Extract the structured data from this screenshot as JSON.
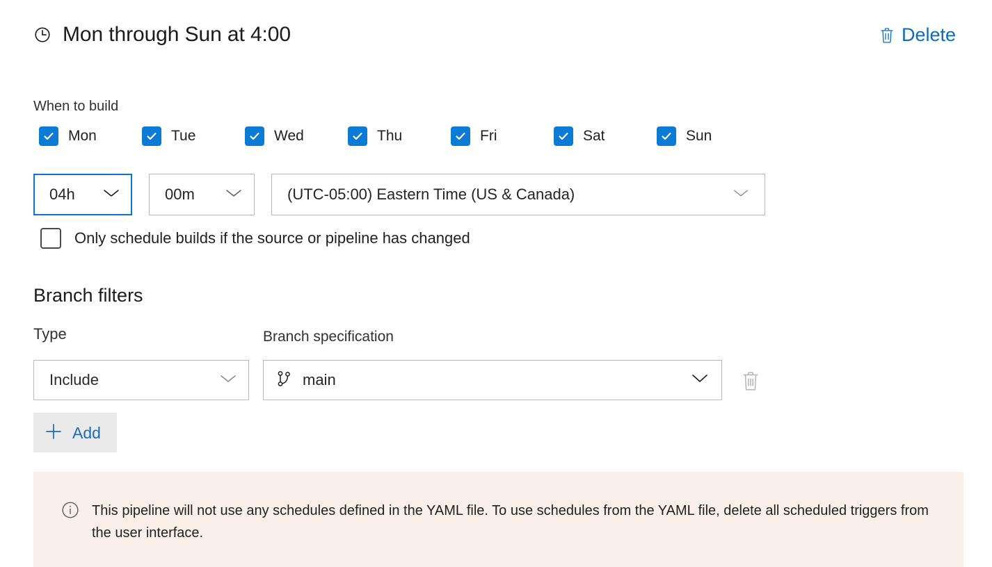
{
  "header": {
    "clock_icon": "clock-icon",
    "title": "Mon through Sun at 4:00",
    "delete_label": "Delete",
    "delete_icon": "trash-icon",
    "accent_color": "#0b6cbf"
  },
  "when_to_build": {
    "label": "When to build",
    "days": [
      {
        "label": "Mon",
        "checked": true
      },
      {
        "label": "Tue",
        "checked": true
      },
      {
        "label": "Wed",
        "checked": true
      },
      {
        "label": "Thu",
        "checked": true
      },
      {
        "label": "Fri",
        "checked": true
      },
      {
        "label": "Sat",
        "checked": true
      },
      {
        "label": "Sun",
        "checked": true
      }
    ],
    "checkbox_color": "#0c7bd6",
    "hours": {
      "value": "04h",
      "focused": true
    },
    "minutes": {
      "value": "00m",
      "focused": false
    },
    "timezone": {
      "value": "(UTC-05:00) Eastern Time (US & Canada)"
    },
    "only_if_changed": {
      "label": "Only schedule builds if the source or pipeline has changed",
      "checked": false
    }
  },
  "branch_filters": {
    "heading": "Branch filters",
    "type_label": "Type",
    "branch_spec_label": "Branch specification",
    "rows": [
      {
        "type": "Include",
        "branch": "main",
        "branch_icon": "git-branch-icon",
        "delete_icon": "trash-icon"
      }
    ],
    "add_label": "Add",
    "add_icon": "plus-icon"
  },
  "info_banner": {
    "icon": "info-circle-icon",
    "text": "This pipeline will not use any schedules defined in the YAML file. To use schedules from the YAML file, delete all scheduled triggers from the user interface.",
    "background_color": "#faefe9"
  }
}
